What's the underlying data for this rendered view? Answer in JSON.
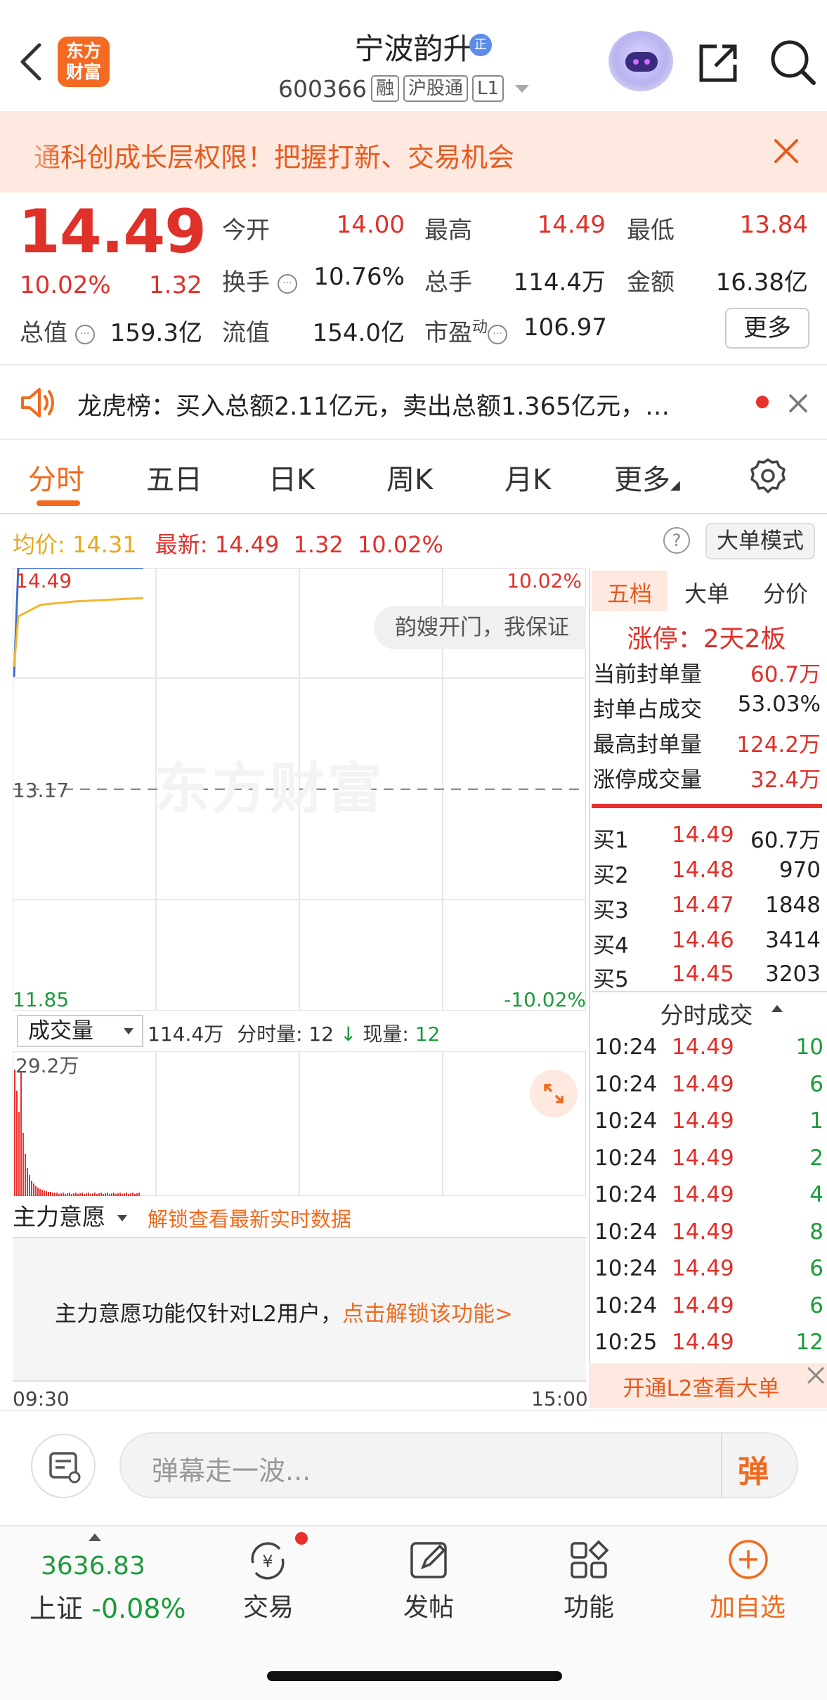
{
  "header": {
    "logo_line1": "东方",
    "logo_line2": "财富",
    "stock_name": "宁波韵升",
    "verify_badge": "正",
    "code": "600366",
    "tags": [
      "融",
      "沪股通",
      "L1"
    ]
  },
  "banner": {
    "text": "通科创成长层权限！把握打新、交易机会"
  },
  "quote": {
    "price": "14.49",
    "change_pct": "10.02%",
    "change_val": "1.32",
    "open_label": "今开",
    "open": "14.00",
    "high_label": "最高",
    "high": "14.49",
    "low_label": "最低",
    "low": "13.84",
    "turnover_label": "换手",
    "turnover": "10.76%",
    "volume_label": "总手",
    "volume": "114.4万",
    "amount_label": "金额",
    "amount": "16.38亿",
    "mktcap_label": "总值",
    "mktcap": "159.3亿",
    "float_label": "流值",
    "float": "154.0亿",
    "pe_label": "市盈",
    "pe_sup": "动",
    "pe": "106.97",
    "more": "更多"
  },
  "lhb": {
    "text": "龙虎榜：买入总额2.11亿元，卖出总额1.365亿元，…"
  },
  "tabs": [
    "分时",
    "五日",
    "日K",
    "周K",
    "月K",
    "更多"
  ],
  "avg_row": {
    "avg_label": "均价:",
    "avg": "14.31",
    "latest_label": "最新:",
    "latest": "14.49",
    "chg": "1.32",
    "pct": "10.02%",
    "bigorder": "大单模式",
    "help": "?"
  },
  "chart": {
    "y_top": "14.49",
    "y_mid": "13.17",
    "y_bottom": "11.85",
    "pct_top": "10.02%",
    "pct_bottom": "-10.02%",
    "watermark": "东方财富",
    "bullet": "韵嫂开门，我保证",
    "time_start": "09:30",
    "time_end": "15:00"
  },
  "chart_data": {
    "type": "line",
    "title": "",
    "series": [
      {
        "name": "",
        "values": [
          13.84,
          14.49,
          14.49,
          14.49,
          14.49,
          14.49
        ]
      },
      {
        "name": "均价",
        "values": [
          13.9,
          14.2,
          14.27,
          14.29,
          14.3,
          14.31
        ]
      }
    ],
    "ylim": [
      11.85,
      14.49
    ],
    "prev_close": 13.17,
    "x_range": [
      "09:30",
      "15:00"
    ]
  },
  "volume": {
    "selector": "成交量",
    "total": "114.4万",
    "tick_label": "分时量:",
    "tick_val": "12",
    "now_label": "现量:",
    "now_val": "12",
    "max_label": "29.2万"
  },
  "main_force": {
    "selector": "主力意愿",
    "unlock": "解锁查看最新实时数据",
    "note": "主力意愿功能仅针对L2用户，",
    "note_link": "点击解锁该功能",
    "note_arrow": ">"
  },
  "right_panel": {
    "tabs": [
      "五档",
      "大单",
      "分价"
    ],
    "limit_title": "涨停：2天2板",
    "stats": [
      {
        "label": "当前封单量",
        "value": "60.7万"
      },
      {
        "label": "封单占成交",
        "value": "53.03%"
      },
      {
        "label": "最高封单量",
        "value": "124.2万"
      },
      {
        "label": "涨停成交量",
        "value": "32.4万"
      }
    ],
    "bids": [
      {
        "label": "买1",
        "price": "14.49",
        "qty": "60.7万"
      },
      {
        "label": "买2",
        "price": "14.48",
        "qty": "970"
      },
      {
        "label": "买3",
        "price": "14.47",
        "qty": "1848"
      },
      {
        "label": "买4",
        "price": "14.46",
        "qty": "3414"
      },
      {
        "label": "买5",
        "price": "14.45",
        "qty": "3203"
      }
    ],
    "ticks_title": "分时成交",
    "ticks": [
      {
        "time": "10:24",
        "price": "14.49",
        "qty": "10"
      },
      {
        "time": "10:24",
        "price": "14.49",
        "qty": "6"
      },
      {
        "time": "10:24",
        "price": "14.49",
        "qty": "1"
      },
      {
        "time": "10:24",
        "price": "14.49",
        "qty": "2"
      },
      {
        "time": "10:24",
        "price": "14.49",
        "qty": "4"
      },
      {
        "time": "10:24",
        "price": "14.49",
        "qty": "8"
      },
      {
        "time": "10:24",
        "price": "14.49",
        "qty": "6"
      },
      {
        "time": "10:24",
        "price": "14.49",
        "qty": "6"
      },
      {
        "time": "10:25",
        "price": "14.49",
        "qty": "12"
      }
    ],
    "l2": "开通L2查看大单"
  },
  "danmu": {
    "placeholder": "弹幕走一波...",
    "toggle": "弹"
  },
  "bottom_nav": {
    "index_value": "3636.83",
    "index_name": "上证",
    "index_change": "-0.08%",
    "items": [
      "交易",
      "发帖",
      "功能",
      "加自选"
    ]
  },
  "colors": {
    "up": "#e0302a",
    "down": "#1b9b3a",
    "accent": "#f06a1e",
    "avg_line": "#f2b632",
    "price_line": "#3b6fd6"
  }
}
